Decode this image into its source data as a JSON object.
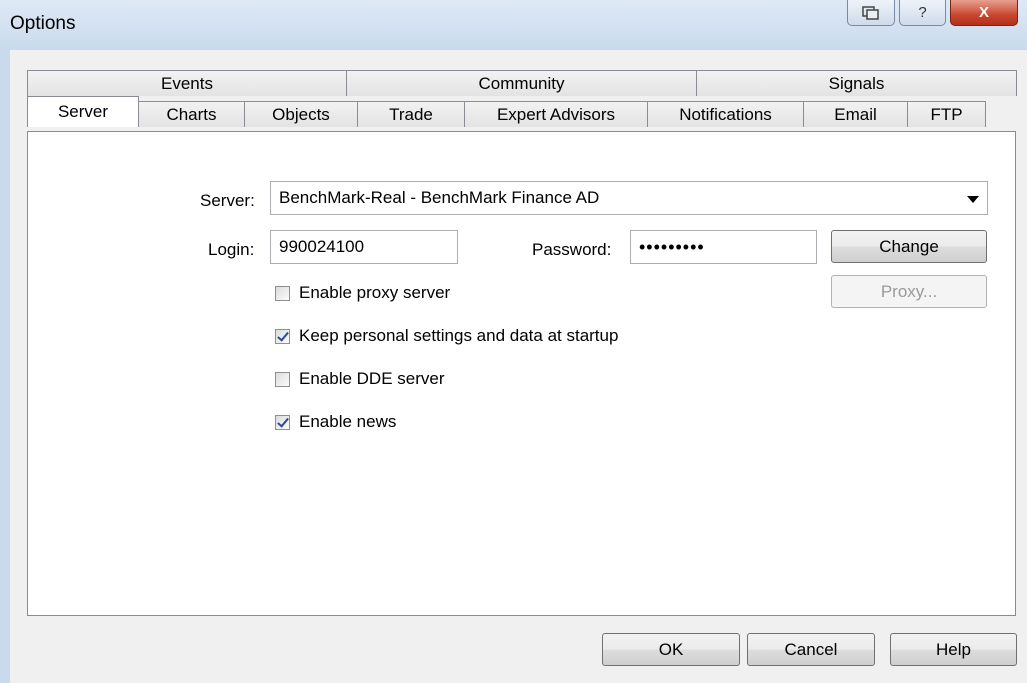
{
  "window": {
    "title": "Options",
    "help_glyph": "?",
    "close_glyph": "X"
  },
  "tabs": {
    "top_row": [
      "Events",
      "Community",
      "Signals"
    ],
    "bottom_row": [
      "Server",
      "Charts",
      "Objects",
      "Trade",
      "Expert Advisors",
      "Notifications",
      "Email",
      "FTP"
    ],
    "active": "Server"
  },
  "server": {
    "server_label": "Server:",
    "server_value": "BenchMark-Real - BenchMark Finance AD",
    "login_label": "Login:",
    "login_value": "990024100",
    "password_label": "Password:",
    "password_value": "•••••••••",
    "change_label": "Change",
    "proxy_label": "Proxy...",
    "checkboxes": [
      {
        "label": "Enable proxy server",
        "checked": false
      },
      {
        "label": "Keep personal settings and data at startup",
        "checked": true
      },
      {
        "label": "Enable DDE server",
        "checked": false
      },
      {
        "label": "Enable news",
        "checked": true
      }
    ]
  },
  "footer": {
    "ok": "OK",
    "cancel": "Cancel",
    "help": "Help"
  }
}
